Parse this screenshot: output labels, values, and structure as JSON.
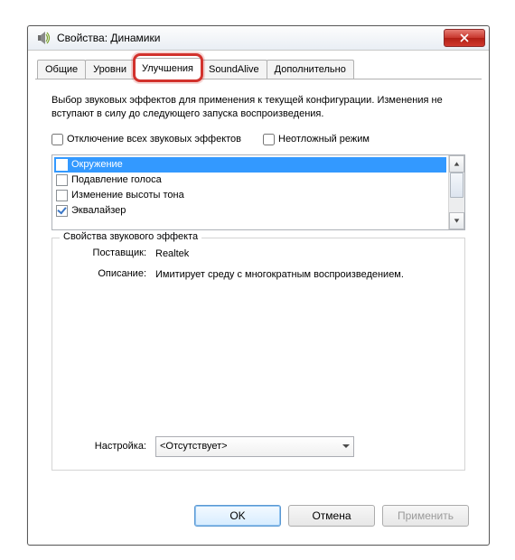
{
  "window": {
    "title": "Свойства: Динамики"
  },
  "tabs": [
    "Общие",
    "Уровни",
    "Улучшения",
    "SoundAlive",
    "Дополнительно"
  ],
  "active_tab_index": 2,
  "body": {
    "description": "Выбор звуковых эффектов для применения к текущей конфигурации. Изменения не вступают в силу до следующего запуска воспроизведения.",
    "disable_all_label": "Отключение всех звуковых эффектов",
    "disable_all_checked": false,
    "immediate_label": "Неотложный режим",
    "immediate_checked": false,
    "effects": [
      {
        "label": "Окружение",
        "checked": false,
        "selected": true
      },
      {
        "label": "Подавление голоса",
        "checked": false,
        "selected": false
      },
      {
        "label": "Изменение высоты тона",
        "checked": false,
        "selected": false
      },
      {
        "label": "Эквалайзер",
        "checked": true,
        "selected": false
      }
    ],
    "group_title": "Свойства звукового эффекта",
    "vendor_label": "Поставщик:",
    "vendor_value": "Realtek",
    "desc_label": "Описание:",
    "desc_value": "Имитирует среду с многократным воспроизведением.",
    "setting_label": "Настройка:",
    "setting_value": "<Отсутствует>"
  },
  "buttons": {
    "ok": "OK",
    "cancel": "Отмена",
    "apply": "Применить"
  },
  "highlight": {
    "target": "tab-enhancements",
    "color": "#d2322d"
  }
}
